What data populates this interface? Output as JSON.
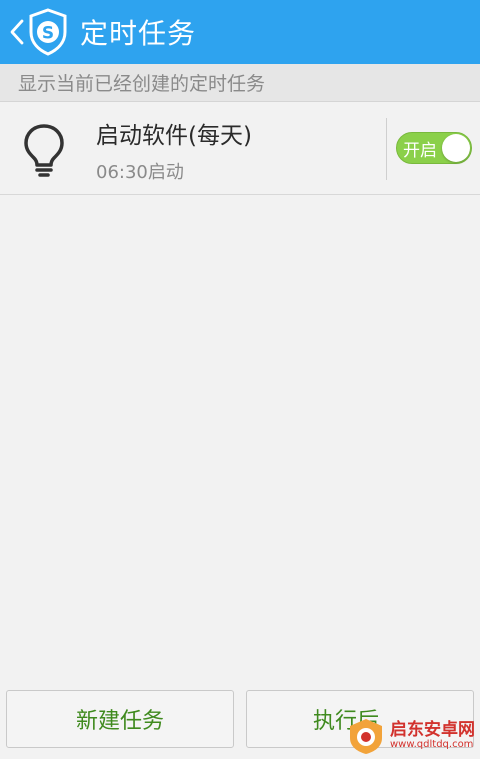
{
  "header": {
    "title": "定时任务",
    "back_icon": "chevron-left-icon",
    "logo_icon": "shield-s-logo-icon",
    "accent_color": "#2ea3ef"
  },
  "subtitle": {
    "text": "显示当前已经创建的定时任务"
  },
  "tasks": [
    {
      "icon": "lightbulb-icon",
      "title": "启动软件(每天)",
      "time": "06:30启动",
      "toggle_label": "开启",
      "enabled": true,
      "toggle_color": "#8bd04a"
    }
  ],
  "bottom": {
    "new_task_label": "新建任务",
    "exec_label": "执行后"
  },
  "watermark": {
    "title": "启东安卓网",
    "url": "www.qdltdq.com"
  }
}
